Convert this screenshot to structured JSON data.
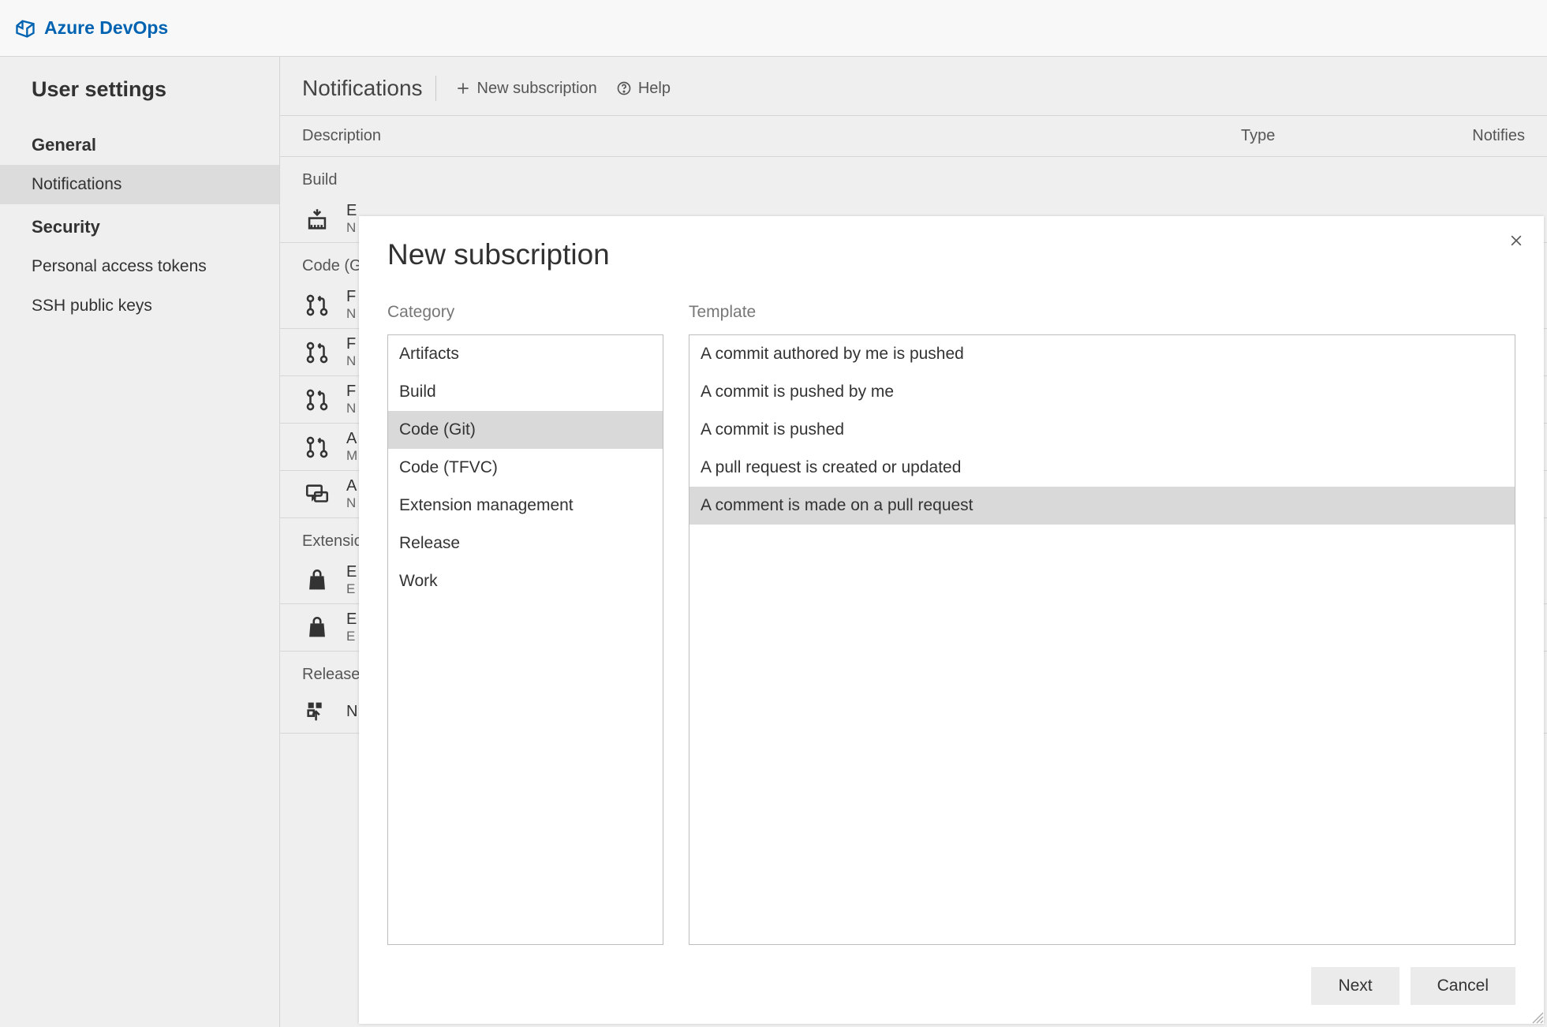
{
  "topbar": {
    "product": "Azure DevOps"
  },
  "sidebar": {
    "title": "User settings",
    "groups": [
      {
        "label": "General",
        "items": [
          {
            "label": "Notifications",
            "selected": true
          }
        ]
      },
      {
        "label": "Security",
        "items": [
          {
            "label": "Personal access tokens"
          },
          {
            "label": "SSH public keys"
          }
        ]
      }
    ]
  },
  "content": {
    "title": "Notifications",
    "actions": {
      "new_subscription": "New subscription",
      "help": "Help"
    },
    "columns": {
      "description": "Description",
      "type": "Type",
      "notifies": "Notifies"
    },
    "sections": [
      {
        "label": "Build",
        "rows": [
          {
            "icon": "build",
            "line1": "E",
            "line2": "N"
          }
        ]
      },
      {
        "label": "Code (G",
        "rows": [
          {
            "icon": "pullrequest",
            "line1": "F",
            "line2": "N"
          },
          {
            "icon": "pullrequest",
            "line1": "F",
            "line2": "N"
          },
          {
            "icon": "pullrequest",
            "line1": "F",
            "line2": "N"
          },
          {
            "icon": "pullrequest",
            "line1": "A",
            "line2": "M"
          },
          {
            "icon": "discussion",
            "line1": "A",
            "line2": "N"
          }
        ]
      },
      {
        "label": "Extensio",
        "rows": [
          {
            "icon": "bag",
            "line1": "E",
            "line2": "E"
          },
          {
            "icon": "bag",
            "line1": "E",
            "line2": "E"
          }
        ]
      },
      {
        "label": "Release",
        "rows": [
          {
            "icon": "release",
            "line1": "N",
            "line2": ""
          }
        ]
      }
    ]
  },
  "modal": {
    "title": "New subscription",
    "category_label": "Category",
    "template_label": "Template",
    "categories": [
      {
        "label": "Artifacts"
      },
      {
        "label": "Build"
      },
      {
        "label": "Code (Git)",
        "selected": true
      },
      {
        "label": "Code (TFVC)"
      },
      {
        "label": "Extension management"
      },
      {
        "label": "Release"
      },
      {
        "label": "Work"
      }
    ],
    "templates": [
      {
        "label": "A commit authored by me is pushed"
      },
      {
        "label": "A commit is pushed by me"
      },
      {
        "label": "A commit is pushed"
      },
      {
        "label": "A pull request is created or updated"
      },
      {
        "label": "A comment is made on a pull request",
        "selected": true
      }
    ],
    "buttons": {
      "next": "Next",
      "cancel": "Cancel"
    }
  }
}
